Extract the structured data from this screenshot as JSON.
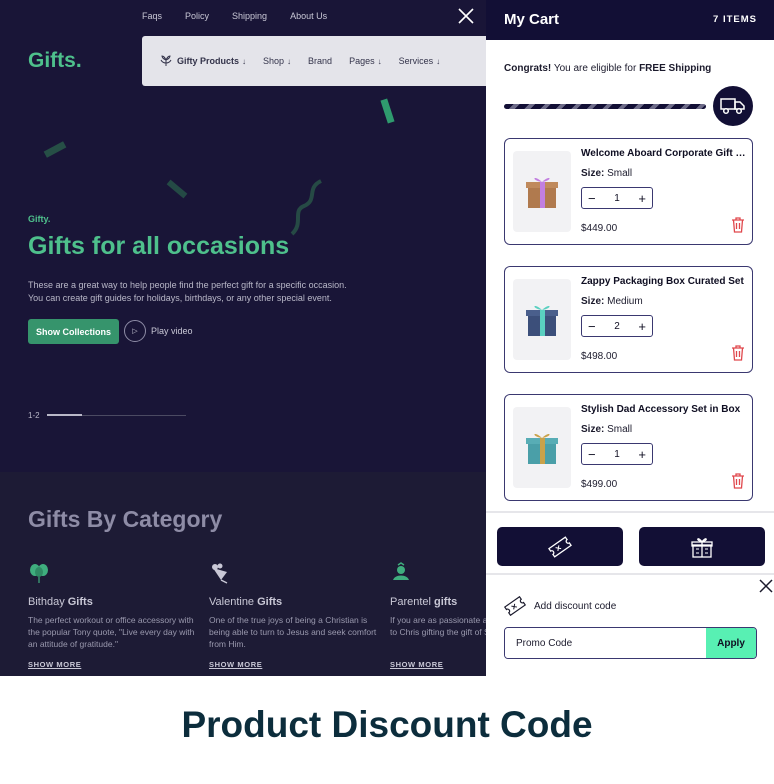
{
  "store": {
    "top_links": [
      "Faqs",
      "Policy",
      "Shipping",
      "About Us"
    ],
    "logo": "Gifts.",
    "menu": [
      {
        "label": "Gifty Products",
        "bold": true,
        "caret": true
      },
      {
        "label": "Shop",
        "bold": false,
        "caret": true
      },
      {
        "label": "Brand",
        "bold": false,
        "caret": false
      },
      {
        "label": "Pages",
        "bold": false,
        "caret": true
      },
      {
        "label": "Services",
        "bold": false,
        "caret": true
      }
    ],
    "hero": {
      "eyebrow": "Gifty.",
      "headline": "Gifts for all occasions",
      "lead": "These are a great way to help people find the perfect gift for a specific occasion. You can create gift guides for holidays, birthdays, or any other special event.",
      "primary_button": "Show Collections",
      "play_label": "Play video",
      "slide_indicator": "1-2",
      "slide_progress": 0.25
    },
    "category_title": "Gifts By Category",
    "categories": [
      {
        "name_plain": "Bithday ",
        "name_bold": "Gifts",
        "desc": "The perfect workout or office accessory with the popular Tony quote, \"Live every day with an attitude of gratitude.\"",
        "more": "SHOW MORE",
        "icon": "balloon-icon"
      },
      {
        "name_plain": "Valentine ",
        "name_bold": "Gifts",
        "desc": "One of the true joys of being a Christian is being able to turn to Jesus and seek comfort from Him.",
        "more": "SHOW MORE",
        "icon": "flowers-icon"
      },
      {
        "name_plain": "Parentel ",
        "name_bold": "gifts",
        "desc": "If you are as passionate a leading lost souls to Chris gifting the gift of Salvation",
        "more": "SHOW MORE",
        "icon": "parent-icon"
      }
    ]
  },
  "cart": {
    "title": "My Cart",
    "count_label": "7 ITEMS",
    "shipping": {
      "prefix": "Congrats!",
      "middle": " You are eligible for ",
      "highlight": "FREE Shipping",
      "progress": 1.0
    },
    "size_label": "Size:",
    "items": [
      {
        "name": "Welcome Aboard Corporate Gift Box",
        "size": "Small",
        "qty": "1",
        "price": "$449.00",
        "box_color": "#b07a4e",
        "ribbon_color": "#c27fe0"
      },
      {
        "name": "Zappy Packaging Box Curated Set",
        "size": "Medium",
        "qty": "2",
        "price": "$498.00",
        "box_color": "#3c4f7a",
        "ribbon_color": "#5ad0c0"
      },
      {
        "name": "Stylish Dad Accessory Set in Box",
        "size": "Small",
        "qty": "1",
        "price": "$499.00",
        "box_color": "#4a9fa8",
        "ribbon_color": "#c9a24a"
      }
    ],
    "actions": [
      "coupon-icon",
      "gift-icon"
    ],
    "discount": {
      "label": "Add discount code",
      "placeholder": "Promo Code",
      "apply": "Apply"
    }
  },
  "caption": "Product Discount Code",
  "colors": {
    "brand": "#120f35",
    "accent": "#4ec08c",
    "apply": "#58f0b3",
    "trash": "#e0474c"
  }
}
